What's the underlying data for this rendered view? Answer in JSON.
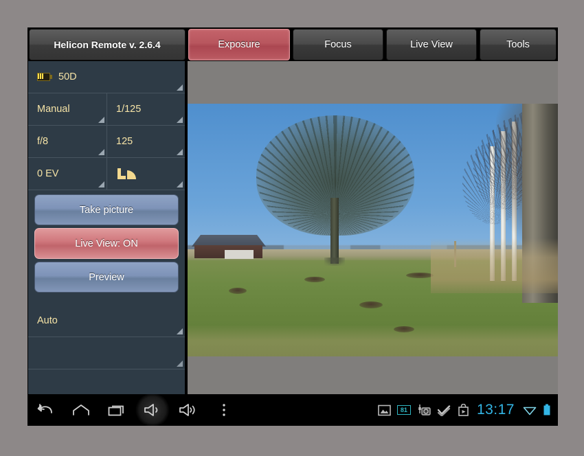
{
  "app": {
    "title": "Helicon Remote v. 2.6.4"
  },
  "tabs": [
    {
      "label": "Exposure",
      "active": true
    },
    {
      "label": "Focus",
      "active": false
    },
    {
      "label": "Live View",
      "active": false
    },
    {
      "label": "Tools",
      "active": false
    }
  ],
  "sidebar": {
    "camera": {
      "icon": "battery-icon",
      "model": "50D"
    },
    "rows": [
      {
        "left": "Manual",
        "right": "1/125"
      },
      {
        "left": "f/8",
        "right": "125"
      },
      {
        "left": "0 EV",
        "right_icon": "metering-mode-icon"
      }
    ],
    "buttons": [
      {
        "label": "Take picture",
        "style": "blue"
      },
      {
        "label": "Live View: ON",
        "style": "red"
      },
      {
        "label": "Preview",
        "style": "blue"
      }
    ],
    "extra_spinners": [
      {
        "label": "Auto"
      },
      {
        "label": ""
      }
    ]
  },
  "liveview": {
    "scene_description": "Bare oak tree in green meadow with birches"
  },
  "navbar": {
    "buttons": [
      {
        "icon": "back-icon",
        "pressed": false
      },
      {
        "icon": "home-icon",
        "pressed": false
      },
      {
        "icon": "recents-icon",
        "pressed": false
      },
      {
        "icon": "volume-down-icon",
        "pressed": true
      },
      {
        "icon": "volume-up-icon",
        "pressed": false
      },
      {
        "icon": "overflow-menu-icon",
        "pressed": false
      }
    ],
    "status": {
      "icons": [
        "gallery-icon",
        "photo-count-badge",
        "usb-camera-icon",
        "double-check-icon",
        "play-store-icon"
      ],
      "photo_count": "81",
      "time": "13:17",
      "wifi": "wifi-icon",
      "battery": "battery-icon"
    }
  },
  "colors": {
    "accent_red": "#b8565e",
    "sidebar_bg": "#2e3b46",
    "label_yellow": "#f5e3a6",
    "button_blue": "#7e93b8",
    "status_cyan": "#33b5e5",
    "page_bg": "#8d8888"
  }
}
